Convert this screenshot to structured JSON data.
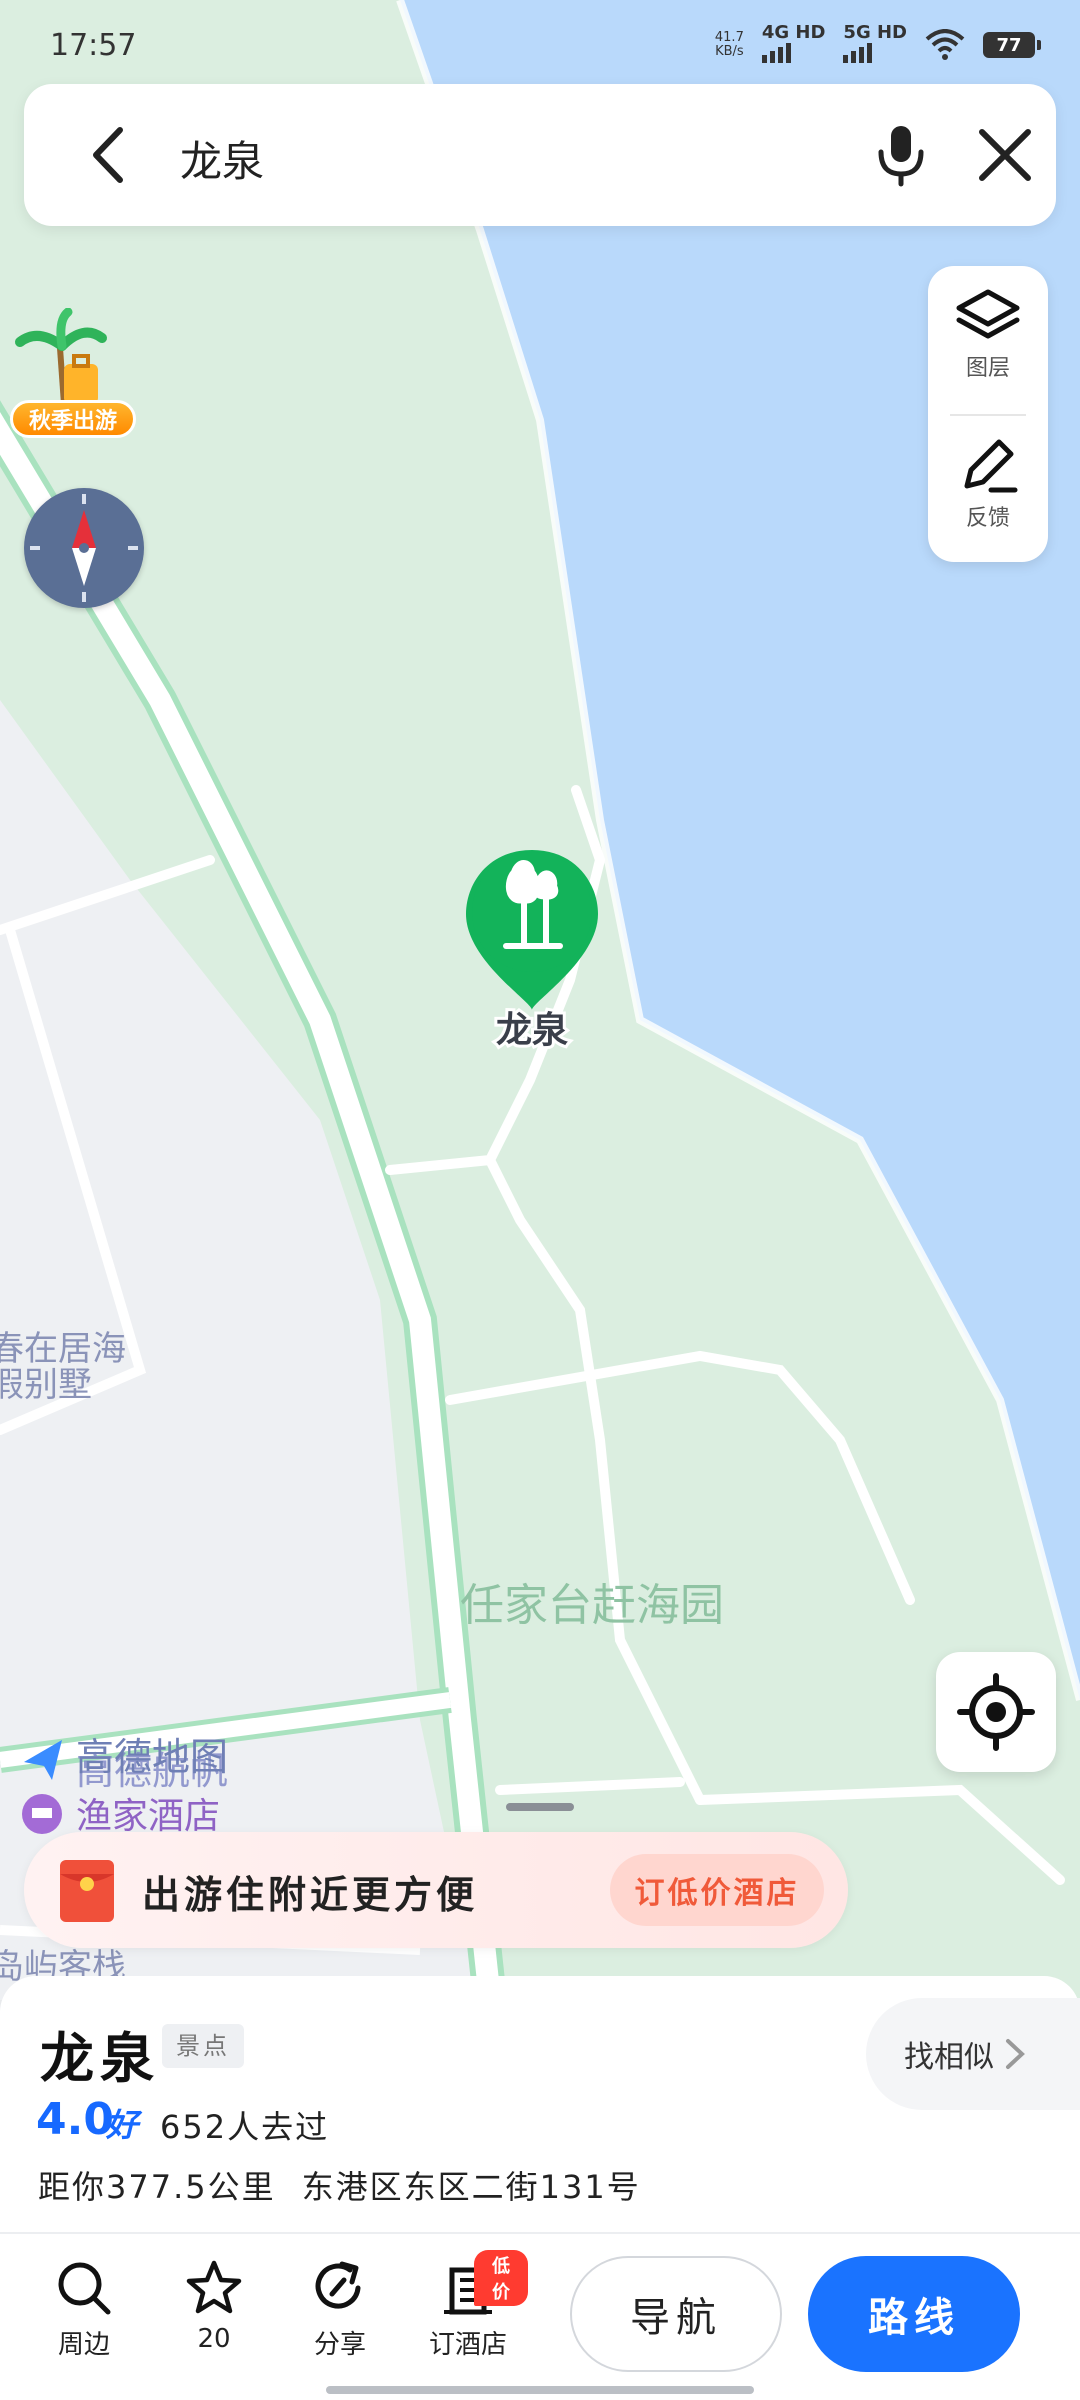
{
  "status_bar": {
    "time": "17:57",
    "net_speed_value": "41.7",
    "net_speed_unit": "KB/s",
    "signal1": "4G HD",
    "signal2": "5G HD",
    "battery": "77"
  },
  "search": {
    "query": "龙泉"
  },
  "promo_float": {
    "label": "秋季出游"
  },
  "tools": {
    "layers": "图层",
    "feedback": "反馈"
  },
  "map": {
    "poi_label": "龙泉",
    "park_label": "任家台赶海园",
    "villa_line1": "春在居海",
    "villa_line2": "假别墅",
    "brand": "高德地图",
    "hotel_label": "渔家酒店",
    "inn_label": "岛屿客栈",
    "hangpai": "高德航帆"
  },
  "promo": {
    "text": "出游住附近更方便",
    "button": "订低价酒店"
  },
  "poi": {
    "name": "龙泉",
    "category": "景点",
    "find_similar": "找相似",
    "rating": "4.0",
    "rating_word": "好",
    "visits": "652人去过",
    "distance": "距你377.5公里",
    "address": "东港区东区二街131号"
  },
  "actions": {
    "nearby": "周边",
    "favorites": "20",
    "share": "分享",
    "hotel": "订酒店",
    "hotel_badge": "低价",
    "navigate": "导航",
    "route": "路线"
  },
  "colors": {
    "water": "#b9d9fb",
    "park": "#dbeee0",
    "land": "#eef0f3",
    "accent": "#1a73ff",
    "poi_green": "#13b35a"
  }
}
